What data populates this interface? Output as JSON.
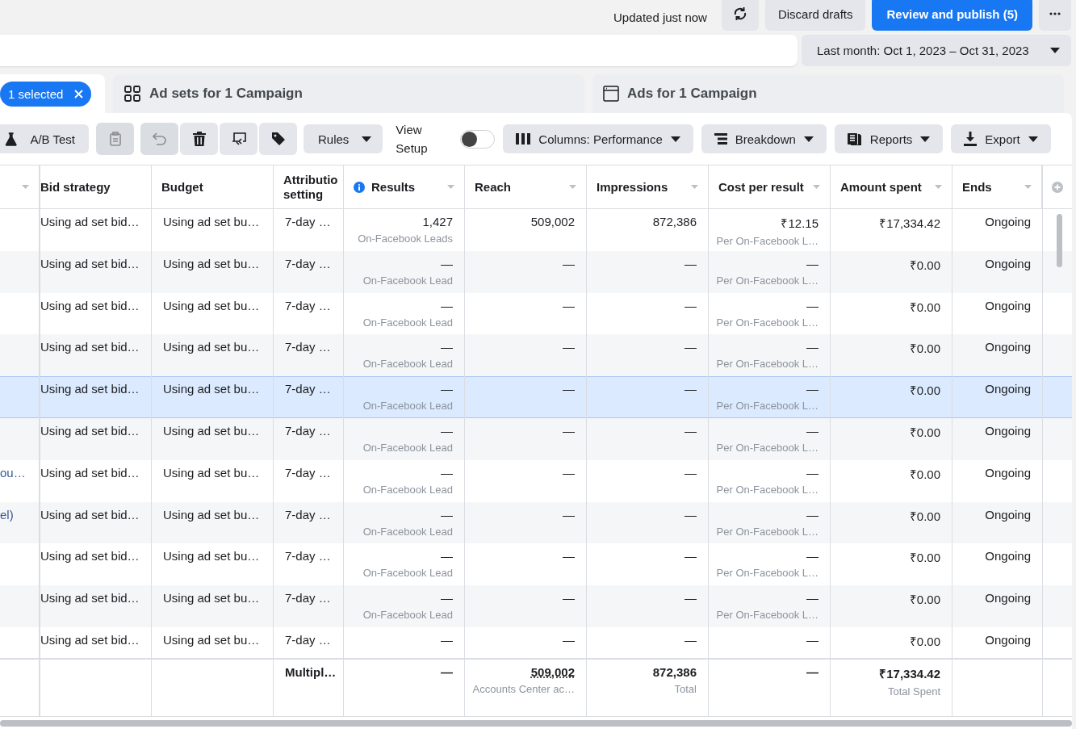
{
  "top_bar": {
    "status": "Updated just now",
    "discard": "Discard drafts",
    "publish": "Review and publish (5)"
  },
  "date_range": {
    "label": "Last month: Oct 1, 2023 – Oct 31, 2023"
  },
  "tabs": [
    {
      "kind": "selection",
      "label": "1 selected",
      "selected": true
    },
    {
      "kind": "ad-sets",
      "label": "Ad sets for 1 Campaign",
      "selected": false
    },
    {
      "kind": "ads",
      "label": "Ads for 1 Campaign",
      "selected": false
    }
  ],
  "toolbar": {
    "ab_test": "A/B Test",
    "icon_buttons": [
      {
        "disabled": true
      },
      {
        "disabled": true
      },
      {
        "disabled": false
      },
      {
        "disabled": false
      },
      {
        "disabled": false
      }
    ],
    "rules": "Rules",
    "view_setup": {
      "label": "View Setup",
      "on": false
    },
    "columns": "Columns: Performance",
    "breakdown": "Breakdown",
    "reports": "Reports",
    "export": "Export"
  },
  "table": {
    "columns": [
      "Bid strategy",
      "Budget",
      "Attributio setting",
      "Results",
      "Reach",
      "Impressions",
      "Cost per result",
      "Amount spent",
      "Ends"
    ],
    "rows": [
      {
        "name": null,
        "bid": "Using ad set bid…",
        "budget": "Using ad set bu…",
        "attribution": "7-day …",
        "results": "1,427",
        "results_sub": "On-Facebook Leads",
        "reach": "509,002",
        "impressions": "872,386",
        "cost": "₹12.15",
        "cost_sub": "Per On-Facebook L…",
        "spent": "₹17,334.42",
        "ends": "Ongoing",
        "hovered": false
      },
      {
        "name": null,
        "bid": "Using ad set bid…",
        "budget": "Using ad set bu…",
        "attribution": "7-day …",
        "results": "—",
        "results_sub": "On-Facebook Lead",
        "reach": "—",
        "impressions": "—",
        "cost": "—",
        "cost_sub": "Per On-Facebook L…",
        "spent": "₹0.00",
        "ends": "Ongoing",
        "hovered": false
      },
      {
        "name": null,
        "bid": "Using ad set bid…",
        "budget": "Using ad set bu…",
        "attribution": "7-day …",
        "results": "—",
        "results_sub": "On-Facebook Lead",
        "reach": "—",
        "impressions": "—",
        "cost": "—",
        "cost_sub": "Per On-Facebook L…",
        "spent": "₹0.00",
        "ends": "Ongoing",
        "hovered": false
      },
      {
        "name": null,
        "bid": "Using ad set bid…",
        "budget": "Using ad set bu…",
        "attribution": "7-day …",
        "results": "—",
        "results_sub": "On-Facebook Lead",
        "reach": "—",
        "impressions": "—",
        "cost": "—",
        "cost_sub": "Per On-Facebook L…",
        "spent": "₹0.00",
        "ends": "Ongoing",
        "hovered": false
      },
      {
        "name": null,
        "bid": "Using ad set bid…",
        "budget": "Using ad set bu…",
        "attribution": "7-day …",
        "results": "—",
        "results_sub": "On-Facebook Lead",
        "reach": "—",
        "impressions": "—",
        "cost": "—",
        "cost_sub": "Per On-Facebook L…",
        "spent": "₹0.00",
        "ends": "Ongoing",
        "hovered": true
      },
      {
        "name": null,
        "bid": "Using ad set bid…",
        "budget": "Using ad set bu…",
        "attribution": "7-day …",
        "results": "—",
        "results_sub": "On-Facebook Lead",
        "reach": "—",
        "impressions": "—",
        "cost": "—",
        "cost_sub": "Per On-Facebook L…",
        "spent": "₹0.00",
        "ends": "Ongoing",
        "hovered": false
      },
      {
        "name": "ou…",
        "bid": "Using ad set bid…",
        "budget": "Using ad set bu…",
        "attribution": "7-day …",
        "results": "—",
        "results_sub": "On-Facebook Lead",
        "reach": "—",
        "impressions": "—",
        "cost": "—",
        "cost_sub": "Per On-Facebook L…",
        "spent": "₹0.00",
        "ends": "Ongoing",
        "hovered": false
      },
      {
        "name": "el)",
        "bid": "Using ad set bid…",
        "budget": "Using ad set bu…",
        "attribution": "7-day …",
        "results": "—",
        "results_sub": "On-Facebook Lead",
        "reach": "—",
        "impressions": "—",
        "cost": "—",
        "cost_sub": "Per On-Facebook L…",
        "spent": "₹0.00",
        "ends": "Ongoing",
        "hovered": false
      },
      {
        "name": null,
        "bid": "Using ad set bid…",
        "budget": "Using ad set bu…",
        "attribution": "7-day …",
        "results": "—",
        "results_sub": "On-Facebook Lead",
        "reach": "—",
        "impressions": "—",
        "cost": "—",
        "cost_sub": "Per On-Facebook L…",
        "spent": "₹0.00",
        "ends": "Ongoing",
        "hovered": false
      },
      {
        "name": null,
        "bid": "Using ad set bid…",
        "budget": "Using ad set bu…",
        "attribution": "7-day …",
        "results": "—",
        "results_sub": "On-Facebook Lead",
        "reach": "—",
        "impressions": "—",
        "cost": "—",
        "cost_sub": "Per On-Facebook L…",
        "spent": "₹0.00",
        "ends": "Ongoing",
        "hovered": false
      },
      {
        "name": null,
        "bid": "Using ad set bid…",
        "budget": "Using ad set bu…",
        "attribution": "7-day …",
        "results": "—",
        "reach": "—",
        "impressions": "—",
        "cost": "—",
        "spent": "₹0.00",
        "ends": "Ongoing",
        "hovered": false
      }
    ],
    "totals": {
      "attribution": "Multipl…",
      "results": "—",
      "reach": "509,002",
      "reach_sub": "Accounts Center ac…",
      "impressions": "872,386",
      "impressions_sub": "Total",
      "cost": "—",
      "spent": "₹17,334.42",
      "spent_sub": "Total Spent"
    }
  }
}
